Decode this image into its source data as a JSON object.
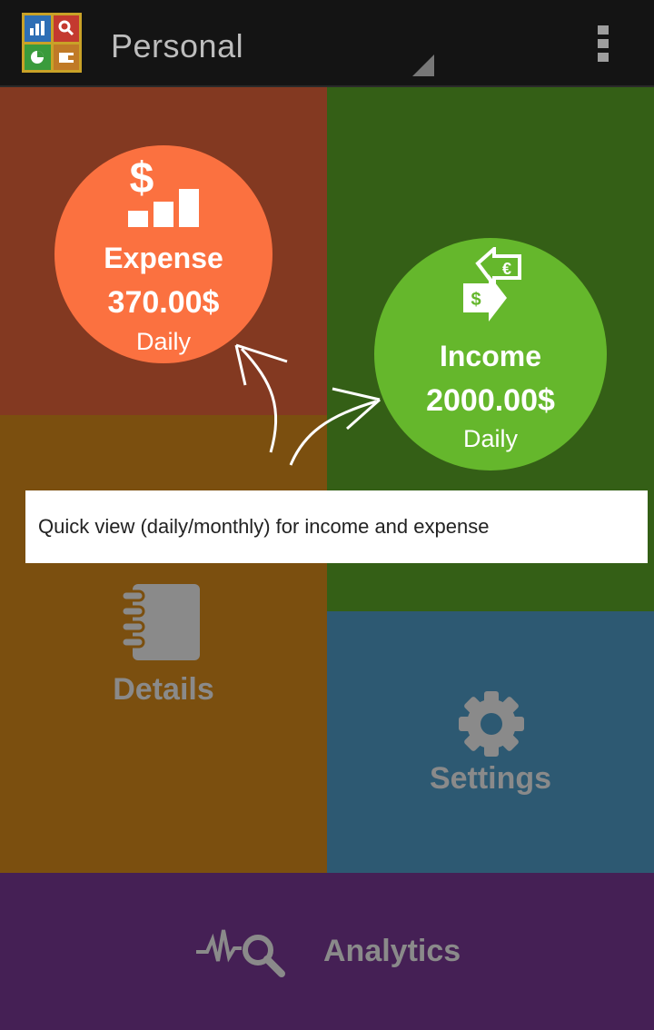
{
  "header": {
    "account_name": "Personal"
  },
  "tiles": {
    "expense": {
      "title": "Expense",
      "amount": "370.00$",
      "period": "Daily",
      "color": "#fb7140"
    },
    "income": {
      "title": "Income",
      "amount": "2000.00$",
      "period": "Daily",
      "color": "#65b72c"
    },
    "details": {
      "label": "Details"
    },
    "settings": {
      "label": "Settings"
    },
    "analytics": {
      "label": "Analytics"
    }
  },
  "tooltip": {
    "text": "Quick view (daily/monthly) for income and expense"
  },
  "icons": {
    "app_logo": "app-logo-icon",
    "overflow_menu": "overflow-menu-icon",
    "expense": "dollar-bars-icon",
    "income": "currency-exchange-icon",
    "details": "notebook-icon",
    "settings": "gear-icon",
    "analytics": "pulse-search-icon"
  },
  "colors": {
    "appbar": "#141414",
    "expense_tile": "#833921",
    "income_tile": "#345f16",
    "details_tile": "#7b4f0f",
    "settings_tile": "#2d5972",
    "analytics_tile": "#452055"
  }
}
